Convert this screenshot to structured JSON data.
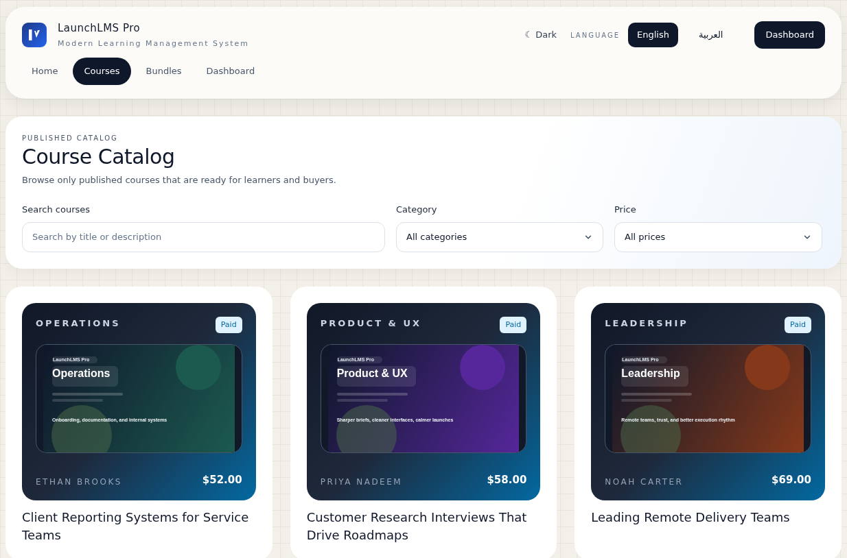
{
  "brand": {
    "name": "LaunchLMS Pro",
    "tagline": "Modern Learning Management System"
  },
  "nav": [
    {
      "label": "Home",
      "selected": false
    },
    {
      "label": "Courses",
      "selected": true
    },
    {
      "label": "Bundles",
      "selected": false
    },
    {
      "label": "Dashboard",
      "selected": false
    }
  ],
  "theme_toggle": {
    "icon": "☾",
    "label": "Dark"
  },
  "language": {
    "label": "LANGUAGE",
    "options": [
      {
        "label": "English",
        "selected": true
      },
      {
        "label": "العربية",
        "selected": false
      }
    ]
  },
  "dashboard_button": "Dashboard",
  "catalog": {
    "eyebrow": "PUBLISHED CATALOG",
    "title": "Course Catalog",
    "subtitle": "Browse only published courses that are ready for learners and buyers.",
    "filters": [
      {
        "kind": "search",
        "label": "Search courses",
        "placeholder": "Search by title or description"
      },
      {
        "kind": "select",
        "label": "Category",
        "value": "All categories"
      },
      {
        "kind": "select",
        "label": "Price",
        "value": "All prices"
      }
    ]
  },
  "courses": [
    {
      "category": "OPERATIONS",
      "badge": "Paid",
      "preview": {
        "brand": "LaunchLMS Pro",
        "title": "Operations",
        "tagline": "Onboarding, documentation, and internal systems"
      },
      "color": "#1c5a50",
      "instructor": "ETHAN BROOKS",
      "price": "$52.00",
      "title": "Client Reporting Systems for Service Teams"
    },
    {
      "category": "PRODUCT & UX",
      "badge": "Paid",
      "preview": {
        "brand": "LaunchLMS Pro",
        "title": "Product & UX",
        "tagline": "Sharper briefs, cleaner interfaces, calmer launches"
      },
      "color": "#55279a",
      "instructor": "PRIYA NADEEM",
      "price": "$58.00",
      "title": "Customer Research Interviews That Drive Roadmaps"
    },
    {
      "category": "LEADERSHIP",
      "badge": "Paid",
      "preview": {
        "brand": "LaunchLMS Pro",
        "title": "Leadership",
        "tagline": "Remote teams, trust, and better execution rhythm"
      },
      "color": "#86391a",
      "instructor": "NOAH CARTER",
      "price": "$69.00",
      "title": "Leading Remote Delivery Teams"
    }
  ]
}
